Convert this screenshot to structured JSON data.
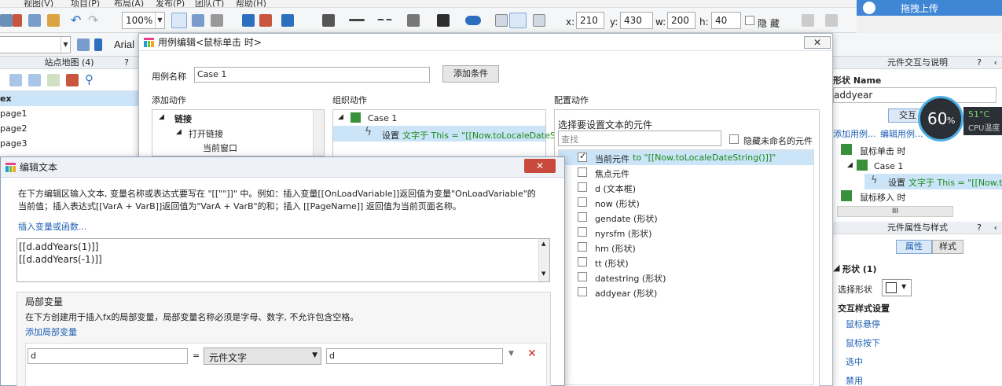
{
  "menubar": {
    "items": [
      "视图(V)",
      "项目(P)",
      "布局(A)",
      "发布(P)",
      "团队(T)",
      "帮助(H)"
    ]
  },
  "toolbar": {
    "zoom": "100%",
    "x_label": "x:",
    "x": "210",
    "y_label": "y:",
    "y": "430",
    "w_label": "w:",
    "w": "200",
    "h_label": "h:",
    "h": "40",
    "hide_label": "隐 藏"
  },
  "toolbar2": {
    "font": "Arial"
  },
  "upload": {
    "label": "拖拽上传"
  },
  "sitemap": {
    "title": "站点地图 (4)",
    "help": "?",
    "items": [
      "ex",
      "page1",
      "page2",
      "page3"
    ]
  },
  "interaction_panel": {
    "title": "元件交互与说明",
    "shape_name_label": "形状 Name",
    "shape_name": "addyear",
    "interact_tab": "交互",
    "add_case": "添加用例...",
    "edit_case": "编辑用例...",
    "tree": [
      "鼠标单击 时",
      "Case 1",
      "设置",
      "文字于 This = \"[[Now.toLo",
      "鼠标移入 时"
    ],
    "scroll": "III"
  },
  "props_panel": {
    "title": "元件属性与样式",
    "tabs": [
      "属性",
      "样式"
    ],
    "shape_section": "形状 (1)",
    "select_shape": "选择形状",
    "style_section": "交互样式设置",
    "styles": [
      "鼠标悬停",
      "鼠标按下",
      "选中",
      "禁用"
    ]
  },
  "cpu": {
    "percent": "60",
    "pct": "%",
    "temp": "51°C",
    "label": "CPU温度"
  },
  "case_dialog": {
    "title": "用例编辑<鼠标单击 时>",
    "close": "✕",
    "case_name_label": "用例名称",
    "case_name": "Case 1",
    "add_condition": "添加条件",
    "add_action_title": "添加动作",
    "organize_title": "组织动作",
    "configure_title": "配置动作",
    "actions": [
      "链接",
      "打开链接",
      "当前窗口"
    ],
    "org_case": "Case 1",
    "org_action": "设置",
    "org_action_detail": "文字于 This = \"[[Now.toLocaleDateStr",
    "select_widget_label": "选择要设置文本的元件",
    "search_placeholder": "查找",
    "hide_unnamed": "隐藏未命名的元件",
    "widgets": [
      {
        "label": "当前元件",
        "detail": " to \"[[Now.toLocaleDateString()]]\"",
        "checked": true
      },
      {
        "label": "焦点元件",
        "detail": "",
        "checked": false
      },
      {
        "label": "d (文本框)",
        "detail": "",
        "checked": false
      },
      {
        "label": "now (形状)",
        "detail": "",
        "checked": false
      },
      {
        "label": "gendate (形状)",
        "detail": "",
        "checked": false
      },
      {
        "label": "nyrsfm (形状)",
        "detail": "",
        "checked": false
      },
      {
        "label": "hm (形状)",
        "detail": "",
        "checked": false
      },
      {
        "label": "tt (形状)",
        "detail": "",
        "checked": false
      },
      {
        "label": "datestring (形状)",
        "detail": "",
        "checked": false
      },
      {
        "label": "addyear (形状)",
        "detail": "",
        "checked": false
      }
    ]
  },
  "edit_dialog": {
    "title": "编辑文本",
    "close": "✕",
    "desc1": "在下方编辑区输入文本, 变量名称或表达式要写在 \"[[\"\"]]\" 中。例如：插入变量[[OnLoadVariable]]返回值为变量\"OnLoadVariable\"的",
    "desc2": "当前值；插入表达式[[VarA + VarB]]返回值为\"VarA + VarB\"的和；插入 [[PageName]] 返回值为当前页面名称。",
    "insert_link": "插入变量或函数...",
    "text_lines": [
      "[[d.addYears(1)]]",
      "[[d.addYears(-1)]]"
    ],
    "local_var_title": "局部变量",
    "local_var_desc": "在下方创建用于插入fx的局部变量，局部变量名称必须是字母、数字, 不允许包含空格。",
    "add_local_var": "添加局部变量",
    "var_name": "d",
    "equals": "=",
    "var_type": "元件文字",
    "var_target": "d",
    "delete": "✕"
  },
  "colors": {
    "accent": "#3f86d4",
    "selected": "#cce4f7",
    "red": "#c94a3c",
    "green": "#1a8a1a"
  }
}
